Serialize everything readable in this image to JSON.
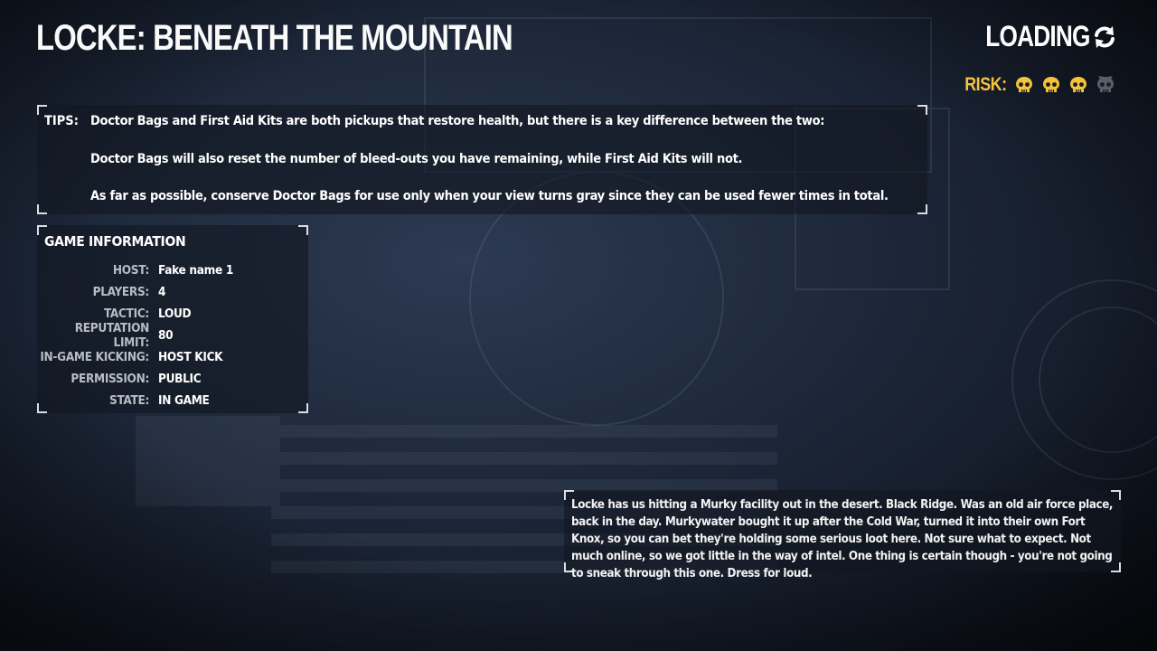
{
  "heist": {
    "title": "LOCKE: BENEATH THE MOUNTAIN"
  },
  "loading": {
    "label": "LOADING",
    "icon": "refresh-icon"
  },
  "risk": {
    "label": "RISK:",
    "level": 3,
    "max": 4,
    "active_color": "#f5c33b",
    "inactive_color": "#5a5e66",
    "icon": "skull-icon"
  },
  "tips": {
    "label": "TIPS:",
    "lines": [
      "Doctor Bags and First Aid Kits are both pickups that restore health, but there is a key difference between the two:",
      "Doctor Bags will also reset the number of bleed-outs you have remaining, while First Aid Kits will not.",
      "As far as possible, conserve Doctor Bags for use only when your view turns gray since they can be used fewer times in total."
    ]
  },
  "game_info": {
    "title": "GAME INFORMATION",
    "rows": [
      {
        "key": "HOST:",
        "value": "Fake name 1"
      },
      {
        "key": "PLAYERS:",
        "value": "4"
      },
      {
        "key": "TACTIC:",
        "value": "LOUD"
      },
      {
        "key": "REPUTATION LIMIT:",
        "value": "80"
      },
      {
        "key": "IN-GAME KICKING:",
        "value": "HOST KICK"
      },
      {
        "key": "PERMISSION:",
        "value": "PUBLIC"
      },
      {
        "key": "STATE:",
        "value": "IN GAME"
      }
    ]
  },
  "briefing": {
    "text": "Locke has us hitting a Murky facility out in the desert. Black Ridge. Was an old air force place, back in the day. Murkywater bought it up after the Cold War, turned it into their own Fort Knox, so you can bet they're holding some serious loot here. Not sure what to expect. Not much online, so we got little in the way of intel. One thing is certain though - you're not going to sneak through this one. Dress for loud."
  },
  "colors": {
    "accent": "#f5c33b",
    "text": "#ffffff",
    "muted": "#b8bcc4"
  }
}
